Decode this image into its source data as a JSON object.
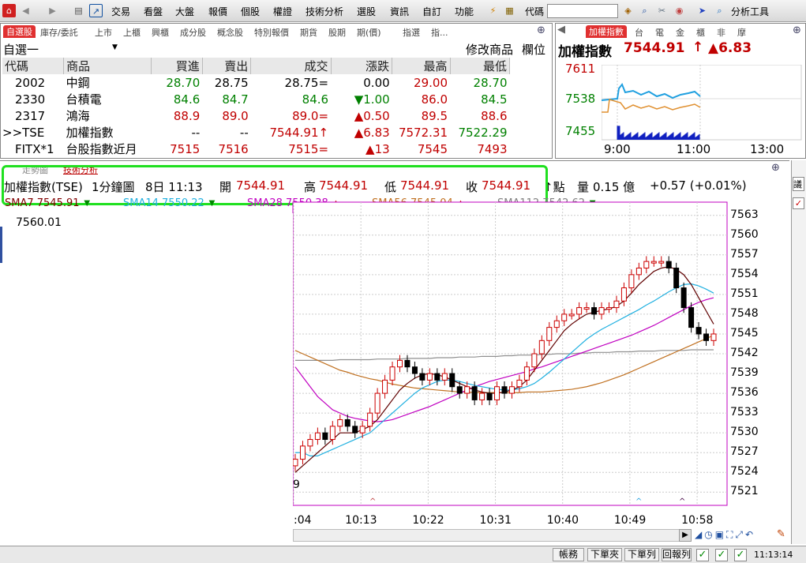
{
  "menu": {
    "items": [
      "交易",
      "看盤",
      "大盤",
      "報價",
      "個股",
      "權證",
      "技術分析",
      "選股",
      "資訊",
      "自訂",
      "功能"
    ],
    "code_label": "代碼",
    "tool_label": "分析工具"
  },
  "quote_tabs": [
    "自選股",
    "庫存/委託",
    "上市",
    "上櫃",
    "興櫃",
    "成分股",
    "概念股",
    "特別報價",
    "期貨",
    "股期",
    "期(價)",
    "指選",
    "指..."
  ],
  "group": {
    "name": "自選一",
    "modify": "修改商品",
    "columns": "欄位"
  },
  "quote_headers": [
    "代碼",
    "商品",
    "買進",
    "賣出",
    "成交",
    "漲跌",
    "最高",
    "最低"
  ],
  "quote_rows": [
    {
      "code": "2002",
      "name": "中鋼",
      "bid": "28.70",
      "ask": "28.75",
      "last": "28.75",
      "mark": "=",
      "arrow": "",
      "chg": "0.00",
      "high": "29.00",
      "low": "28.70",
      "c": [
        "grn",
        "blk",
        "blk",
        "blk",
        "red",
        "grn"
      ]
    },
    {
      "code": "2330",
      "name": "台積電",
      "bid": "84.6",
      "ask": "84.7",
      "last": "84.6",
      "mark": "",
      "arrow": "▼",
      "chg": "1.00",
      "high": "86.0",
      "low": "84.5",
      "c": [
        "grn",
        "grn",
        "grn",
        "grn",
        "red",
        "grn"
      ]
    },
    {
      "code": "2317",
      "name": "鴻海",
      "bid": "88.9",
      "ask": "89.0",
      "last": "89.0",
      "mark": "=",
      "arrow": "▲",
      "chg": "0.50",
      "high": "89.5",
      "low": "88.6",
      "c": [
        "red",
        "red",
        "red",
        "red",
        "red",
        "red"
      ]
    },
    {
      "code": ">>TSE",
      "name": "加權指數",
      "bid": "--",
      "ask": "--",
      "last": "7544.91",
      "mark": "↑",
      "arrow": "▲",
      "chg": "6.83",
      "high": "7572.31",
      "low": "7522.29",
      "c": [
        "blk",
        "blk",
        "red",
        "red",
        "red",
        "grn"
      ]
    },
    {
      "code": "FITX*1",
      "name": "台股指數近月",
      "bid": "7515",
      "ask": "7516",
      "last": "7515",
      "mark": "=",
      "arrow": "▲",
      "chg": "13",
      "high": "7545",
      "low": "7493",
      "c": [
        "red",
        "red",
        "red",
        "red",
        "red",
        "red"
      ]
    }
  ],
  "mini": {
    "tabs": [
      "加權指數",
      "台",
      "電",
      "金",
      "櫃",
      "非",
      "摩"
    ],
    "title": "加權指數",
    "price": "7544.91",
    "up_arrow": "↑",
    "change": "▲6.83",
    "y_labels": [
      "7611",
      "7538",
      "7455"
    ],
    "x_labels": [
      "9:00",
      "11:00",
      "13:00"
    ]
  },
  "chart_tabs": [
    "走勢圖",
    "技術分析"
  ],
  "chart_header": {
    "symbol": "加權指數(TSE)",
    "period": "1分鐘圖",
    "date": "8日 11:13",
    "open_label": "開",
    "open": "7544.91",
    "high_label": "高",
    "high": "7544.91",
    "low_label": "低",
    "low": "7544.91",
    "close_label": "收",
    "close": "7544.91",
    "unit": "↑點",
    "vol_label": "量",
    "vol": "0.15 億",
    "change": "+0.57 (+0.01%)"
  },
  "sma_legend": [
    {
      "t": "SMA7 7545.91",
      "color": "#800000"
    },
    {
      "t": "SMA14 7550.22",
      "color": "#20b0e0"
    },
    {
      "t": "SMA28 7550.38",
      "color": "#c000c0"
    },
    {
      "t": "SMA56 7545.04",
      "color": "#c07020"
    },
    {
      "t": "SMA112 7542.62",
      "color": "#808080"
    }
  ],
  "overlay": {
    "top_value": "7560.01",
    "bottom_value": "9"
  },
  "chart_data": {
    "type": "candlestick",
    "title": "",
    "xlabel": "",
    "ylabel": "",
    "ylim": [
      7519,
      7565
    ],
    "y_ticks": [
      7563,
      7560,
      7557,
      7554,
      7551,
      7548,
      7545,
      7542,
      7539,
      7536,
      7533,
      7530,
      7527,
      7524,
      7521
    ],
    "x_ticks": [
      ":04",
      "10:13",
      "10:22",
      "10:31",
      "10:40",
      "10:49",
      "10:58"
    ],
    "closes": [
      7526,
      7528,
      7529,
      7530,
      7529,
      7531,
      7532,
      7531,
      7530,
      7531,
      7533,
      7536,
      7538,
      7540,
      7541,
      7540,
      7539,
      7538,
      7539,
      7538,
      7539,
      7537,
      7536,
      7537,
      7535,
      7536,
      7535,
      7537,
      7536,
      7537,
      7538,
      7540,
      7542,
      7544,
      7546,
      7547,
      7548,
      7548,
      7549,
      7549,
      7548,
      7549,
      7549,
      7550,
      7552,
      7554,
      7555,
      7556,
      7556,
      7556,
      7555,
      7552,
      7549,
      7546,
      7545,
      7544,
      7545
    ],
    "sma7": [
      7524,
      7525,
      7526,
      7527,
      7528,
      7529,
      7530,
      7530,
      7530,
      7530.5,
      7531,
      7532,
      7533.5,
      7535,
      7536.5,
      7537.5,
      7538.3,
      7538.8,
      7539,
      7538.8,
      7538.5,
      7538,
      7537.5,
      7537,
      7536.5,
      7536.2,
      7536,
      7536,
      7536.2,
      7536.5,
      7537,
      7538,
      7539.5,
      7541,
      7542.5,
      7544,
      7545.5,
      7546.5,
      7547.3,
      7548,
      7548.3,
      7548.6,
      7548.8,
      7549.2,
      7550,
      7551.2,
      7552.5,
      7553.5,
      7554.5,
      7555,
      7555.2,
      7554.8,
      7554,
      7552.5,
      7550.5,
      7548.5,
      7546.5
    ],
    "sma14": [
      7527,
      7527,
      7526.5,
      7526.5,
      7527,
      7527.5,
      7528,
      7528.5,
      7529,
      7529.5,
      7530,
      7531,
      7532,
      7533,
      7534,
      7535,
      7536,
      7536.8,
      7537.3,
      7537.8,
      7538,
      7538,
      7537.8,
      7537.5,
      7537.2,
      7537,
      7536.8,
      7536.6,
      7536.5,
      7536.5,
      7536.7,
      7537,
      7537.5,
      7538.3,
      7539.2,
      7540.2,
      7541.2,
      7542.2,
      7543.2,
      7544.2,
      7545,
      7545.7,
      7546.3,
      7546.9,
      7547.5,
      7548.1,
      7548.7,
      7549.4,
      7550,
      7550.7,
      7551.4,
      7552,
      7552.5,
      7552.6,
      7552.3,
      7551.8,
      7551.2
    ],
    "sma28": [
      7540,
      7538.5,
      7537,
      7535.5,
      7534.5,
      7533.5,
      7533,
      7532.5,
      7532.2,
      7532,
      7531.8,
      7531.7,
      7531.8,
      7532,
      7532.4,
      7532.8,
      7533.2,
      7533.6,
      7534,
      7534.5,
      7535,
      7535.5,
      7536,
      7536.5,
      7537,
      7537.4,
      7537.8,
      7538.1,
      7538.4,
      7538.7,
      7539,
      7539.3,
      7539.7,
      7540,
      7540.4,
      7540.8,
      7541.2,
      7541.6,
      7542,
      7542.4,
      7542.8,
      7543.2,
      7543.6,
      7544,
      7544.4,
      7544.8,
      7545.3,
      7545.8,
      7546.3,
      7546.9,
      7547.5,
      7548.1,
      7548.7,
      7549.3,
      7549.8,
      7550.2,
      7550.5
    ],
    "sma56": [
      7542.5,
      7542,
      7541.5,
      7541,
      7540.5,
      7540,
      7539.5,
      7539.2,
      7538.8,
      7538.5,
      7538.2,
      7538,
      7537.7,
      7537.4,
      7537.2,
      7537,
      7536.8,
      7536.7,
      7536.6,
      7536.5,
      7536.4,
      7536.3,
      7536.2,
      7536.2,
      7536.1,
      7536.1,
      7536.1,
      7536.1,
      7536.1,
      7536.1,
      7536.1,
      7536.2,
      7536.2,
      7536.2,
      7536.3,
      7536.4,
      7536.5,
      7536.6,
      7536.8,
      7537,
      7537.3,
      7537.6,
      7538,
      7538.4,
      7538.8,
      7539.3,
      7539.8,
      7540.3,
      7540.8,
      7541.3,
      7541.8,
      7542.3,
      7542.8,
      7543.3,
      7543.8,
      7544.3,
      7544.8
    ],
    "sma112": [
      7541,
      7541,
      7541,
      7541,
      7541,
      7541,
      7541.1,
      7541.1,
      7541.1,
      7541.1,
      7541.1,
      7541.2,
      7541.2,
      7541.2,
      7541.2,
      7541.3,
      7541.3,
      7541.3,
      7541.3,
      7541.4,
      7541.4,
      7541.4,
      7541.5,
      7541.5,
      7541.5,
      7541.6,
      7541.6,
      7541.6,
      7541.7,
      7541.7,
      7541.8,
      7541.8,
      7541.8,
      7541.9,
      7541.9,
      7542,
      7542,
      7542,
      7542.1,
      7542.1,
      7542.2,
      7542.2,
      7542.2,
      7542.3,
      7542.3,
      7542.3,
      7542.4,
      7542.4,
      7542.4,
      7542.5,
      7542.5,
      7542.5,
      7542.5,
      7542.6,
      7542.6,
      7542.6,
      7542.6
    ]
  },
  "statusbar": {
    "buttons": [
      "帳務",
      "下單夾",
      "下單列",
      "回報列"
    ],
    "time": "11:13:14"
  },
  "right_tabs": [
    "議"
  ]
}
